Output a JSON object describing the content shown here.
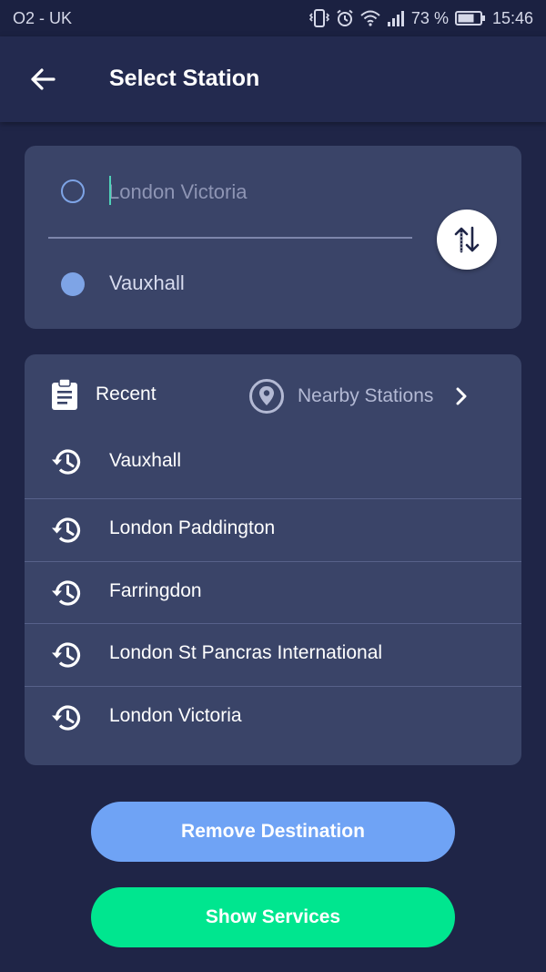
{
  "status_bar": {
    "carrier": "O2 - UK",
    "battery": "73 %",
    "time": "15:46",
    "icons": [
      "vibrate-icon",
      "alarm-icon",
      "wifi-icon",
      "signal-icon",
      "battery-icon"
    ]
  },
  "header": {
    "title": "Select Station",
    "back_icon": "arrow-left-icon"
  },
  "route": {
    "origin_placeholder": "London Victoria",
    "origin_value": "",
    "destination": "Vauxhall",
    "swap_icon": "swap-vertical-icon"
  },
  "recent": {
    "tab_recent": "Recent",
    "tab_nearby": "Nearby Stations",
    "items": [
      "Vauxhall",
      "London Paddington",
      "Farringdon",
      "London St Pancras International",
      "London Victoria"
    ]
  },
  "actions": {
    "remove_label": "Remove Destination",
    "show_label": "Show Services"
  },
  "colors": {
    "background": "#1f2547",
    "card": "#3a4468",
    "accent_blue": "#6fa3f5",
    "accent_green": "#00e68f"
  }
}
